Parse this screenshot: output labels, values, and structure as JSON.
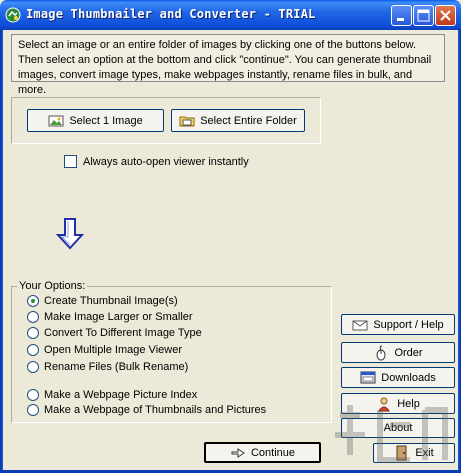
{
  "window": {
    "title": "Image Thumbnailer and Converter - TRIAL"
  },
  "intro": {
    "text": "Select an image or an entire folder of images by clicking one of the buttons below. Then select an option at the bottom and click \"continue\". You can generate thumbnail images, convert image types, make webpages instantly, rename files in bulk, and more."
  },
  "select": {
    "one_label": "Select 1 Image",
    "folder_label": "Select Entire Folder"
  },
  "auto_open": {
    "label": "Always auto-open viewer instantly",
    "checked": false
  },
  "options": {
    "legend": "Your Options:",
    "items": [
      {
        "label": "Create Thumbnail Image(s)",
        "selected": true
      },
      {
        "label": "Make Image Larger or Smaller",
        "selected": false
      },
      {
        "label": "Convert To Different Image Type",
        "selected": false
      },
      {
        "label": "Open Multiple Image Viewer",
        "selected": false
      },
      {
        "label": "Rename Files (Bulk Rename)",
        "selected": false
      },
      {
        "label": "Make a Webpage Picture Index",
        "selected": false
      },
      {
        "label": "Make a Webpage of Thumbnails and Pictures",
        "selected": false
      }
    ]
  },
  "side": {
    "support_label": "Support / Help",
    "order_label": "Order",
    "downloads_label": "Downloads",
    "help_label": "Help",
    "about_label": "About",
    "exit_label": "Exit"
  },
  "footer": {
    "continue_label": "Continue"
  },
  "icons": [
    "app-icon",
    "minimize-icon",
    "maximize-icon",
    "close-icon",
    "image-icon",
    "folder-icon",
    "down-arrow-icon",
    "envelope-icon",
    "mouse-icon",
    "downloads-icon",
    "help-icon",
    "exit-icon",
    "continue-icon"
  ],
  "colors": {
    "titlebar": "#0A58E8",
    "window": "#ECE9D8",
    "arrow": "#1F2FA8",
    "radio_dot": "#2F8C2F"
  }
}
